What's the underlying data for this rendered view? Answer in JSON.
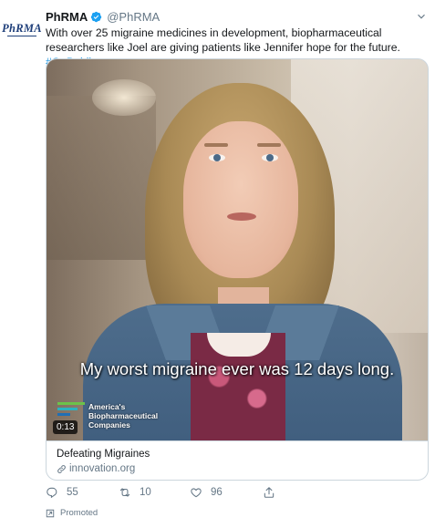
{
  "author": {
    "avatar_text": "PhRMA",
    "name": "PhRMA",
    "handle": "@PhRMA",
    "verified_icon": "verified-badge-icon"
  },
  "tweet": {
    "text": "With over 25 migraine medicines in development, biopharmaceutical researchers like Joel are giving patients like Jennifer hope for the future.",
    "hashtag": "#GoBoldly"
  },
  "video": {
    "subtitle": "My worst migraine ever was 12 days long.",
    "brand_lines": [
      "America's",
      "Biopharmaceutical",
      "Companies"
    ],
    "brand_colors": [
      "#6cc24a",
      "#2bb3c0",
      "#1f6fb5"
    ],
    "duration": "0:13"
  },
  "card": {
    "title": "Defeating Migraines",
    "domain": "innovation.org"
  },
  "actions": {
    "replies": "55",
    "retweets": "10",
    "likes": "96"
  },
  "promoted_label": "Promoted",
  "colors": {
    "link_blue": "#1b95e0",
    "muted_gray": "#657786",
    "border": "#ccd6dd"
  }
}
